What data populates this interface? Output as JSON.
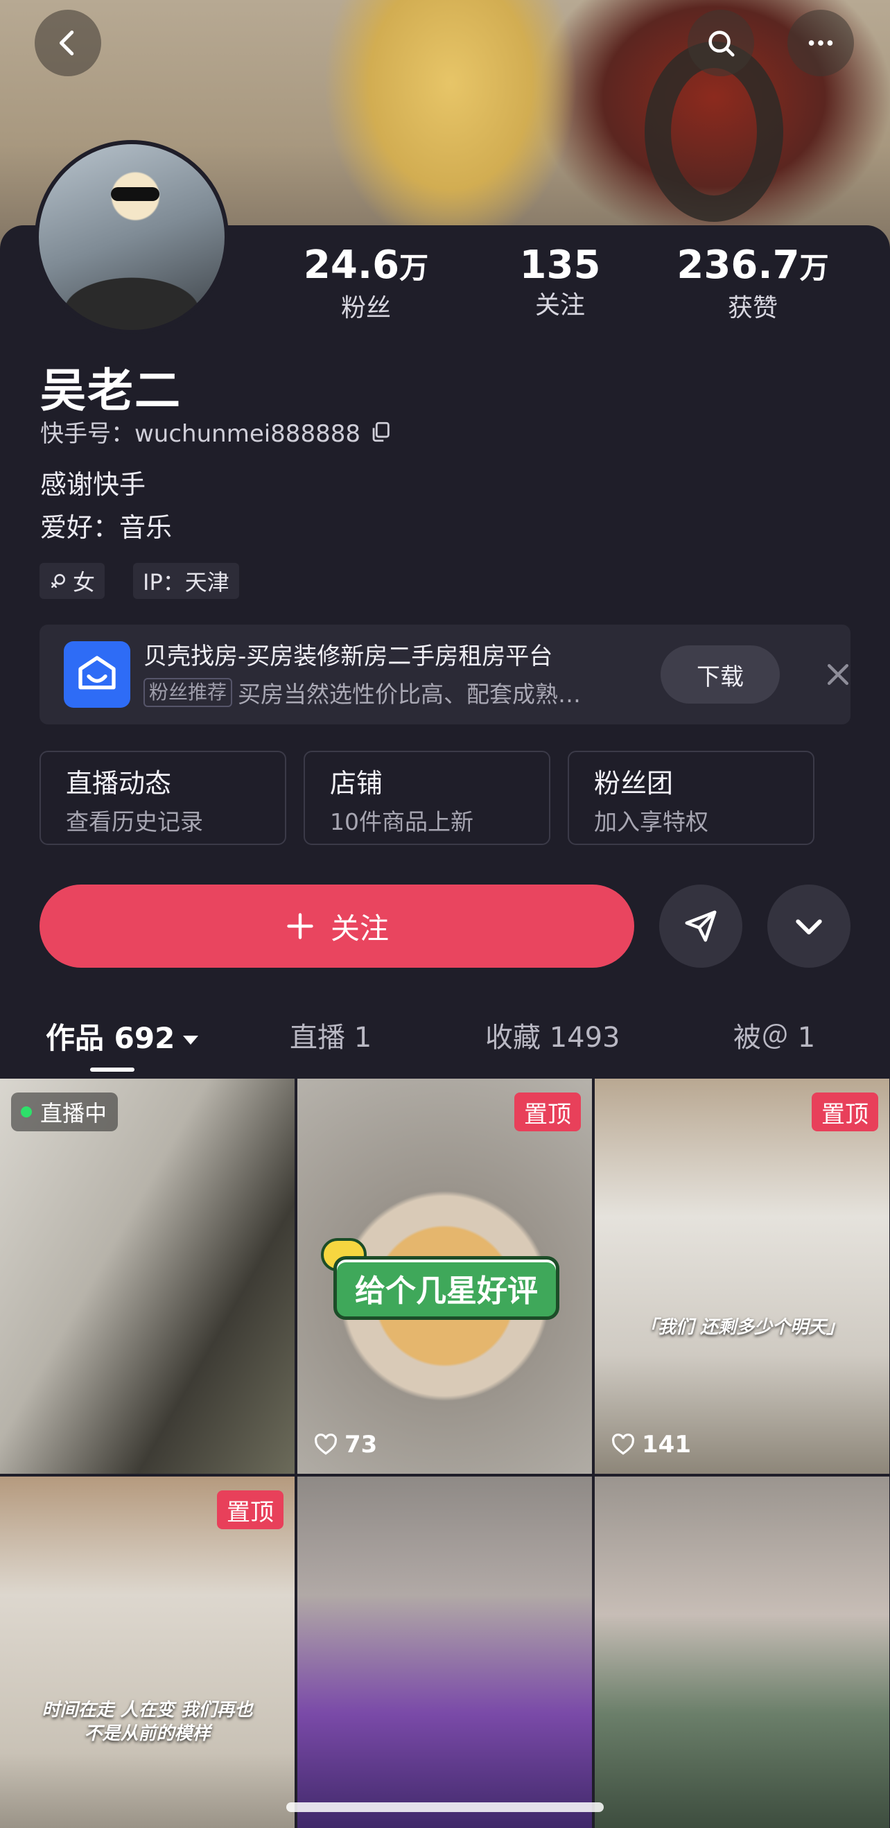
{
  "profile": {
    "name": "吴老二",
    "kuaishou_id": "快手号：wuchunmei888888",
    "bio_line1": "感谢快手",
    "bio_line2": "爱好：音乐",
    "gender_tag": "女",
    "ip_tag": "IP：天津"
  },
  "stats": {
    "fans_num": "24.6",
    "fans_unit": "万",
    "fans_label": "粉丝",
    "following_num": "135",
    "following_label": "关注",
    "likes_num": "236.7",
    "likes_unit": "万",
    "likes_label": "获赞"
  },
  "ad": {
    "title": "贝壳找房-买房装修新房二手房租房平台",
    "badge": "粉丝推荐",
    "subtitle": "买房当然选性价比高、配套成熟…",
    "download_label": "下载"
  },
  "entries": [
    {
      "title": "直播动态",
      "subtitle": "查看历史记录"
    },
    {
      "title": "店铺",
      "subtitle": "10件商品上新"
    },
    {
      "title": "粉丝团",
      "subtitle": "加入享特权"
    }
  ],
  "actions": {
    "follow_label": "关注"
  },
  "tabs": [
    {
      "label": "作品 692"
    },
    {
      "label": "直播 1"
    },
    {
      "label": "收藏 1493"
    },
    {
      "label": "被＠ 1"
    }
  ],
  "grid": [
    {
      "live_label": "直播中"
    },
    {
      "pinned": "置顶",
      "sticker": "给个几星好评",
      "likes": "73"
    },
    {
      "pinned": "置顶",
      "caption": "「我们 还剩多少个明天」",
      "likes": "141"
    },
    {
      "pinned": "置顶",
      "caption_line1": "时间在走 人在变 我们再也",
      "caption_line2": "不是从前的模样"
    },
    {},
    {}
  ],
  "colors": {
    "accent": "#e9455f",
    "background": "#1f1e29",
    "live_dot": "#2ee06a"
  },
  "icons": [
    "back-icon",
    "search-icon",
    "more-icon",
    "copy-icon",
    "female-icon",
    "share-icon",
    "chevron-down-icon",
    "heart-icon",
    "close-icon",
    "plus-icon"
  ]
}
